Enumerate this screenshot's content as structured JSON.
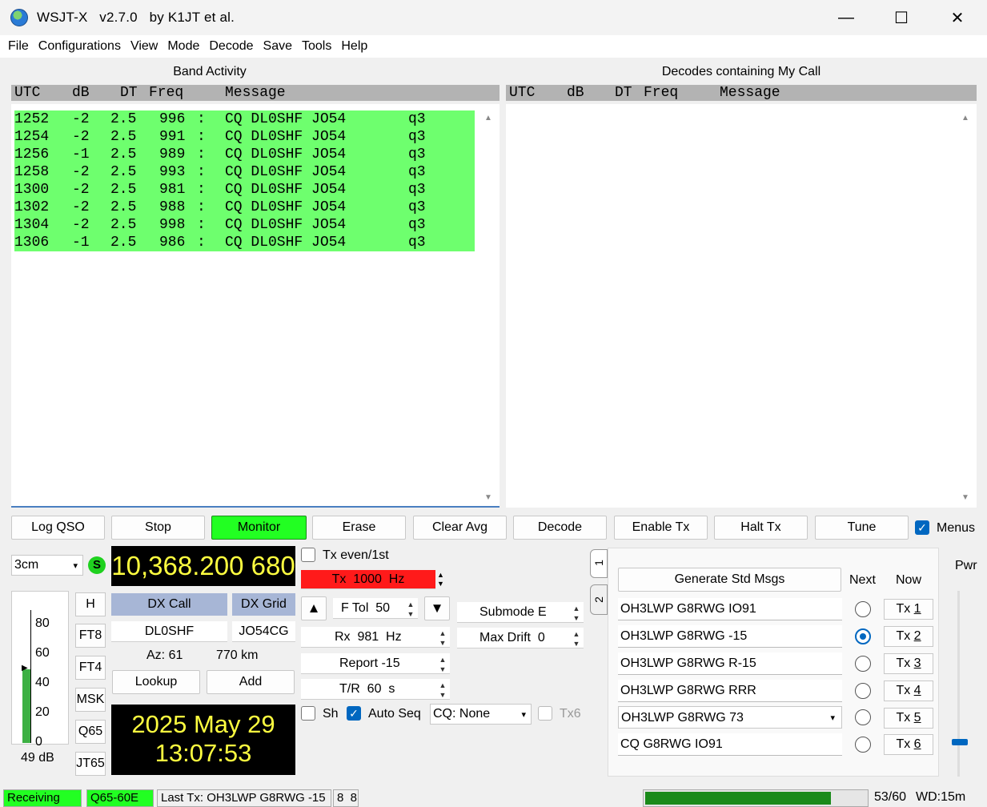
{
  "window": {
    "title": "WSJT-X   v2.7.0   by K1JT et al.",
    "minimize": "—",
    "maximize": "☐",
    "close": "✕"
  },
  "menu": [
    "File",
    "Configurations",
    "View",
    "Mode",
    "Decode",
    "Save",
    "Tools",
    "Help"
  ],
  "band_activity": {
    "label": "Band Activity",
    "headers": {
      "utc": "UTC",
      "db": "dB",
      "dt": "DT",
      "freq": "Freq",
      "message": "Message"
    },
    "rows": [
      {
        "utc": "1252",
        "db": "-2",
        "dt": "2.5",
        "freq": "996",
        "sep": ":",
        "msg": "CQ DL0SHF JO54",
        "q": "q3"
      },
      {
        "utc": "1254",
        "db": "-2",
        "dt": "2.5",
        "freq": "991",
        "sep": ":",
        "msg": "CQ DL0SHF JO54",
        "q": "q3"
      },
      {
        "utc": "1256",
        "db": "-1",
        "dt": "2.5",
        "freq": "989",
        "sep": ":",
        "msg": "CQ DL0SHF JO54",
        "q": "q3"
      },
      {
        "utc": "1258",
        "db": "-2",
        "dt": "2.5",
        "freq": "993",
        "sep": ":",
        "msg": "CQ DL0SHF JO54",
        "q": "q3"
      },
      {
        "utc": "1300",
        "db": "-2",
        "dt": "2.5",
        "freq": "981",
        "sep": ":",
        "msg": "CQ DL0SHF JO54",
        "q": "q3"
      },
      {
        "utc": "1302",
        "db": "-2",
        "dt": "2.5",
        "freq": "988",
        "sep": ":",
        "msg": "CQ DL0SHF JO54",
        "q": "q3"
      },
      {
        "utc": "1304",
        "db": "-2",
        "dt": "2.5",
        "freq": "998",
        "sep": ":",
        "msg": "CQ DL0SHF JO54",
        "q": "q3"
      },
      {
        "utc": "1306",
        "db": "-1",
        "dt": "2.5",
        "freq": "986",
        "sep": ":",
        "msg": "CQ DL0SHF JO54",
        "q": "q3"
      }
    ],
    "row_color": "#6eff6e"
  },
  "my_call": {
    "label": "Decodes containing My Call",
    "headers": {
      "utc": "UTC",
      "db": "dB",
      "dt": "DT",
      "freq": "Freq",
      "message": "Message"
    }
  },
  "buttons": {
    "log_qso": "Log QSO",
    "stop": "Stop",
    "monitor": "Monitor",
    "erase": "Erase",
    "clear_avg": "Clear Avg",
    "decode": "Decode",
    "enable_tx": "Enable Tx",
    "halt_tx": "Halt Tx",
    "tune": "Tune",
    "menus": "Menus"
  },
  "band": "3cm",
  "s_badge": "S",
  "dial_frequency": "10,368.200 680",
  "meter": {
    "ticks": [
      "80",
      "60",
      "40",
      "20",
      "0"
    ],
    "level_db": "49 dB"
  },
  "modes": [
    "H",
    "FT8",
    "FT4",
    "MSK",
    "Q65",
    "JT65"
  ],
  "dx": {
    "call_label": "DX Call",
    "grid_label": "DX Grid",
    "call": "DL0SHF",
    "grid": "JO54CG",
    "az": "Az: 61",
    "distance": "770 km",
    "lookup": "Lookup",
    "add": "Add"
  },
  "clock": {
    "date": "2025 May 29",
    "time": "13:07:53"
  },
  "controls": {
    "tx_even": "Tx even/1st",
    "tx_freq": "Tx  1000  Hz",
    "f_tol": "F Tol  50",
    "rx_freq": "Rx  981  Hz",
    "report": "Report -15",
    "tr": "T/R  60  s",
    "submode": "Submode E",
    "max_drift": "Max Drift  0",
    "sh": "Sh",
    "auto_seq": "Auto Seq",
    "cq": "CQ: None",
    "tx6": "Tx6",
    "up": "▲",
    "down": "▼"
  },
  "tabs": [
    "1",
    "2"
  ],
  "messages": {
    "generate": "Generate Std Msgs",
    "next": "Next",
    "now": "Now",
    "pwr": "Pwr",
    "list": [
      {
        "text": "OH3LWP G8RWG IO91",
        "btn_prefix": "Tx ",
        "btn_num": "1",
        "selected": false
      },
      {
        "text": "OH3LWP G8RWG -15",
        "btn_prefix": "Tx ",
        "btn_num": "2",
        "selected": true
      },
      {
        "text": "OH3LWP G8RWG R-15",
        "btn_prefix": "Tx ",
        "btn_num": "3",
        "selected": false
      },
      {
        "text": "OH3LWP G8RWG RRR",
        "btn_prefix": "Tx ",
        "btn_num": "4",
        "selected": false
      },
      {
        "text": "OH3LWP G8RWG 73",
        "btn_prefix": "Tx ",
        "btn_num": "5",
        "selected": false
      },
      {
        "text": "CQ G8RWG IO91",
        "btn_prefix": "Tx ",
        "btn_num": "6",
        "selected": false
      }
    ]
  },
  "status": {
    "receiving": "Receiving",
    "mode": "Q65-60E",
    "last_tx": "Last Tx: OH3LWP G8RWG -15",
    "small": "8  8",
    "progress_fraction": 0.84,
    "counter": "53/60",
    "wd": "WD:15m"
  }
}
